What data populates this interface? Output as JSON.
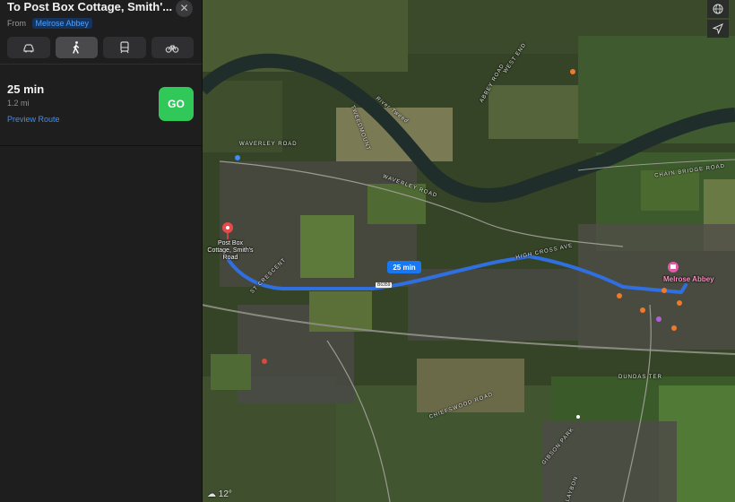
{
  "header": {
    "title": "To Post Box Cottage, Smith'...",
    "from_label": "From",
    "origin": "Melrose Abbey"
  },
  "transport_modes": [
    {
      "icon": "car-icon",
      "selected": false
    },
    {
      "icon": "walk-icon",
      "selected": true
    },
    {
      "icon": "transit-icon",
      "selected": false
    },
    {
      "icon": "bicycle-icon",
      "selected": false
    }
  ],
  "route": {
    "time": "25 min",
    "distance": "1.2 mi",
    "preview_label": "Preview Route",
    "go_label": "GO"
  },
  "map": {
    "eta_bubble": "25 min",
    "destination_label": "Post Box Cottage, Smith's Road",
    "origin_label": "Melrose Abbey",
    "road_shield": "B6359",
    "street_labels": {
      "river_tweed": "River Tweed",
      "waverley_road": "WAVERLEY ROAD",
      "waverley_road_2": "WAVERLEY ROAD",
      "high_cross_ave": "HIGH CROSS AVE",
      "chain_bridge_road": "CHAIN BRIDGE ROAD",
      "dundas_ter": "DUNDAS TER",
      "chiefswood_road": "CHIEFSWOOD ROAD",
      "gibson_park": "GIBSON PARK",
      "abbey_road": "ABBEY ROAD",
      "west_end": "WEST END",
      "claybon": "CLAYBON",
      "tweedmount": "TWEEDMOUNT",
      "st_crescent": "ST CRESCENT"
    },
    "temperature": "12°",
    "route_color": "#2f6fe0",
    "water_color": "#1f2e2a"
  }
}
